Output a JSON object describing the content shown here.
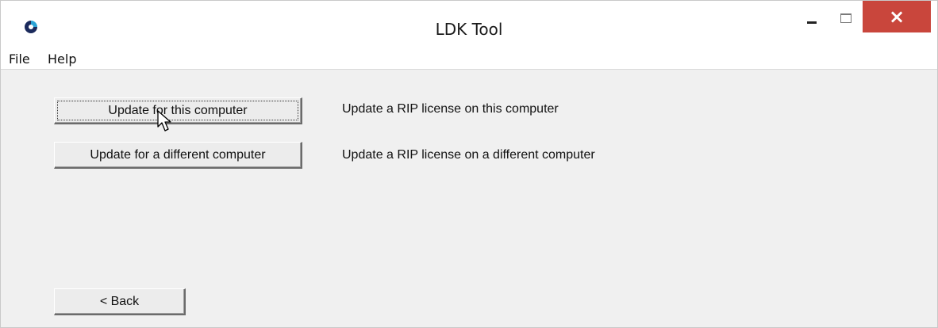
{
  "window": {
    "title": "LDK Tool",
    "close_symbol": "×"
  },
  "menu": {
    "items": [
      "File",
      "Help"
    ]
  },
  "actions": {
    "update_this": {
      "button_label": "Update for this computer",
      "description": "Update a RIP license on this computer"
    },
    "update_different": {
      "button_label": "Update for a different computer",
      "description": "Update a RIP license on a different computer"
    },
    "back_label": "< Back"
  },
  "icons": {
    "app": "app-logo-icon",
    "cursor": "mouse-pointer-icon",
    "minimize": "minimize-icon",
    "maximize": "maximize-icon",
    "close": "close-icon"
  },
  "colors": {
    "close_button": "#c9463c",
    "window_background": "#f0f0f0"
  }
}
